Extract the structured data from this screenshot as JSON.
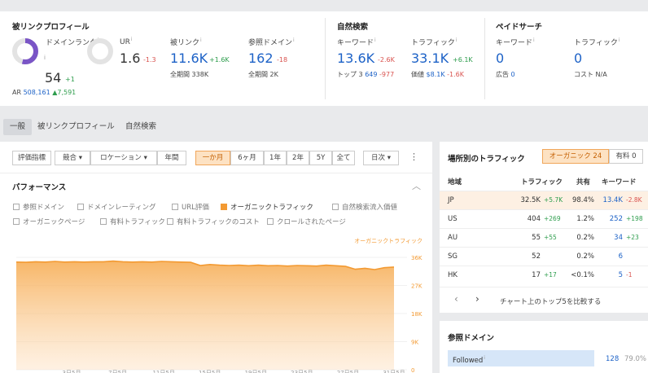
{
  "backlink": {
    "title": "被リンクプロフィール",
    "dr_label": "ドメインランク",
    "dr_value": "54",
    "dr_delta": "+1",
    "ar_label": "AR",
    "ar_value": "508,161",
    "ar_delta": "▲7,591",
    "ur_label": "UR",
    "ur_value": "1.6",
    "ur_delta": "-1.3",
    "bl_label": "被リンク",
    "bl_value": "11.6K",
    "bl_delta": "+1.6K",
    "bl_sub_label": "全期間",
    "bl_sub_value": "338K",
    "rd_label": "参照ドメイン",
    "rd_value": "162",
    "rd_delta": "-18",
    "rd_sub_label": "全期間",
    "rd_sub_value": "2K"
  },
  "organic": {
    "title": "自然検索",
    "kw_label": "キーワード",
    "kw_value": "13.6K",
    "kw_delta": "-2.6K",
    "top3_label": "トップ 3",
    "top3_value": "649",
    "top3_delta": "-977",
    "tr_label": "トラフィック",
    "tr_value": "33.1K",
    "tr_delta": "+6.1K",
    "val_label": "価値",
    "val_value": "$8.1K",
    "val_delta": "-1.6K"
  },
  "paid": {
    "title": "ペイドサーチ",
    "kw_label": "キーワード",
    "kw_value": "0",
    "ads_label": "広告",
    "ads_value": "0",
    "tr_label": "トラフィック",
    "tr_value": "0",
    "cost_label": "コスト",
    "cost_value": "N/A"
  },
  "tabs": [
    "一般",
    "被リンクプロフィール",
    "自然検索"
  ],
  "toolbar": {
    "metrics": "評価指標",
    "compare": "競合",
    "location": "ロケーション",
    "years": "年間",
    "ranges": [
      "一か月",
      "6ヶ月",
      "1年",
      "2年",
      "5Y",
      "全て"
    ],
    "interval": "日次",
    "more": "⋮"
  },
  "performance": {
    "title": "パフォーマンス",
    "collapse": "︿",
    "checks": [
      {
        "label": "参照ドメイン",
        "on": false
      },
      {
        "label": "ドメインレーティング",
        "on": false
      },
      {
        "label": "URL評価",
        "on": false
      },
      {
        "label": "オーガニックトラフィック",
        "on": true
      },
      {
        "label": "自然検索流入価値",
        "on": false
      },
      {
        "label": "オーガニックページ",
        "on": false
      },
      {
        "label": "有料トラフィック",
        "on": false
      },
      {
        "label": "有料トラフィックのコスト",
        "on": false
      },
      {
        "label": "クロールされたページ",
        "on": false
      }
    ]
  },
  "chart_data": {
    "type": "area",
    "series": [
      {
        "name": "オーガニックトラフィック",
        "values": [
          34500,
          34400,
          34600,
          34500,
          34700,
          34500,
          34600,
          34500,
          34600,
          34600,
          34800,
          34600,
          34500,
          34600,
          34500,
          34700,
          34600,
          34500,
          34400,
          33400,
          33700,
          33500,
          33400,
          33500,
          33300,
          33500,
          33300,
          33400,
          33200,
          33400,
          33300,
          33200,
          33500,
          33300,
          33100,
          32200,
          32500,
          32100,
          32700,
          32900
        ]
      }
    ],
    "x_ticks": [
      "3日5月",
      "7日5月",
      "11日5月",
      "15日5月",
      "19日5月",
      "23日5月",
      "27日5月",
      "31日5月"
    ],
    "y_ticks": [
      "36K",
      "27K",
      "18K",
      "9K",
      "0"
    ],
    "ylim": [
      0,
      36000
    ],
    "color": "#f39a32"
  },
  "traffic": {
    "title": "場所別のトラフィック",
    "organic_btn": "オーガニック 24",
    "paid_btn": "有料 0",
    "headers": [
      "地域",
      "トラフィック",
      "共有",
      "キーワード"
    ],
    "rows": [
      {
        "loc": "JP",
        "traffic": "32.5K",
        "tdelta": "+5.7K",
        "share": "98.4%",
        "kw": "13.4K",
        "kdelta": "-2.8K",
        "kneg": true
      },
      {
        "loc": "US",
        "traffic": "404",
        "tdelta": "+269",
        "share": "1.2%",
        "kw": "252",
        "kdelta": "+198",
        "kneg": false
      },
      {
        "loc": "AU",
        "traffic": "55",
        "tdelta": "+55",
        "share": "0.2%",
        "kw": "34",
        "kdelta": "+23",
        "kneg": false
      },
      {
        "loc": "SG",
        "traffic": "52",
        "tdelta": "",
        "share": "0.2%",
        "kw": "6",
        "kdelta": "",
        "kneg": false
      },
      {
        "loc": "HK",
        "traffic": "17",
        "tdelta": "+17",
        "share": "<0.1%",
        "kw": "5",
        "kdelta": "-1",
        "kneg": true
      }
    ],
    "compare_text": "チャート上のトップ5を比較する",
    "prev": "‹",
    "next": "›"
  },
  "refdomains": {
    "title": "参照ドメイン",
    "followed_label": "Followed",
    "followed_value": "128",
    "followed_pct": "79.0%",
    "followed_fraction": 0.79
  }
}
